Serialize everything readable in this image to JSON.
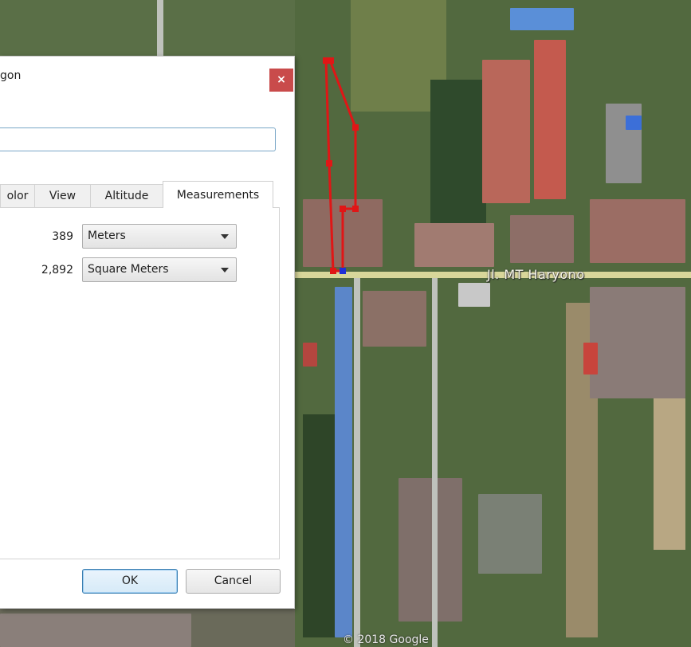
{
  "dialog": {
    "title": "gon",
    "close_label": "×",
    "name_value": "",
    "tabs": [
      {
        "label": "olor",
        "active": false
      },
      {
        "label": "View",
        "active": false
      },
      {
        "label": "Altitude",
        "active": false
      },
      {
        "label": "Measurements",
        "active": true
      }
    ],
    "measurements": {
      "perimeter": {
        "value": "389",
        "unit": "Meters"
      },
      "area": {
        "value": "2,892",
        "unit": "Square Meters"
      }
    },
    "ok_label": "OK",
    "cancel_label": "Cancel"
  },
  "map": {
    "road_label": "Jl. MT Haryono",
    "copyright": "© 2018 Google",
    "polygon_color": "#e01616",
    "selected_vertex_color": "#1f2fd8"
  }
}
